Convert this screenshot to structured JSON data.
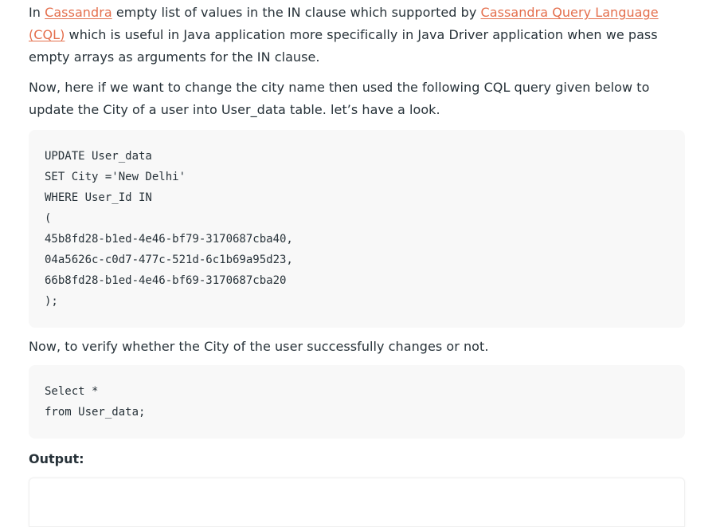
{
  "paragraph1": {
    "prefix": "In ",
    "link1": "Cassandra",
    "middle": " empty list of values in the IN clause which supported by ",
    "link2": "Cassandra Query Language (CQL)",
    "suffix": " which is useful in Java application more specifically in Java Driver application when we pass empty arrays as arguments for the IN clause."
  },
  "paragraph2": "Now, here if we want to change the city name then used the following CQL query given below to update the City of a user into User_data table. let’s have a look.",
  "code_block_1": [
    "UPDATE User_data",
    "SET City ='New Delhi'",
    "WHERE User_Id IN",
    "(",
    "45b8fd28-b1ed-4e46-bf79-3170687cba40,",
    "04a5626c-c0d7-477c-521d-6c1b69a95d23,",
    "66b8fd28-b1ed-4e46-bf69-3170687cba20",
    ");"
  ],
  "paragraph3": "Now, to verify whether the City of the user successfully changes or not.",
  "code_block_2": [
    "Select *",
    "from User_data;"
  ],
  "output_heading": "Output:",
  "colors": {
    "link": "#e46f4d",
    "text": "#273239",
    "code_background": "#f8f8f8"
  }
}
